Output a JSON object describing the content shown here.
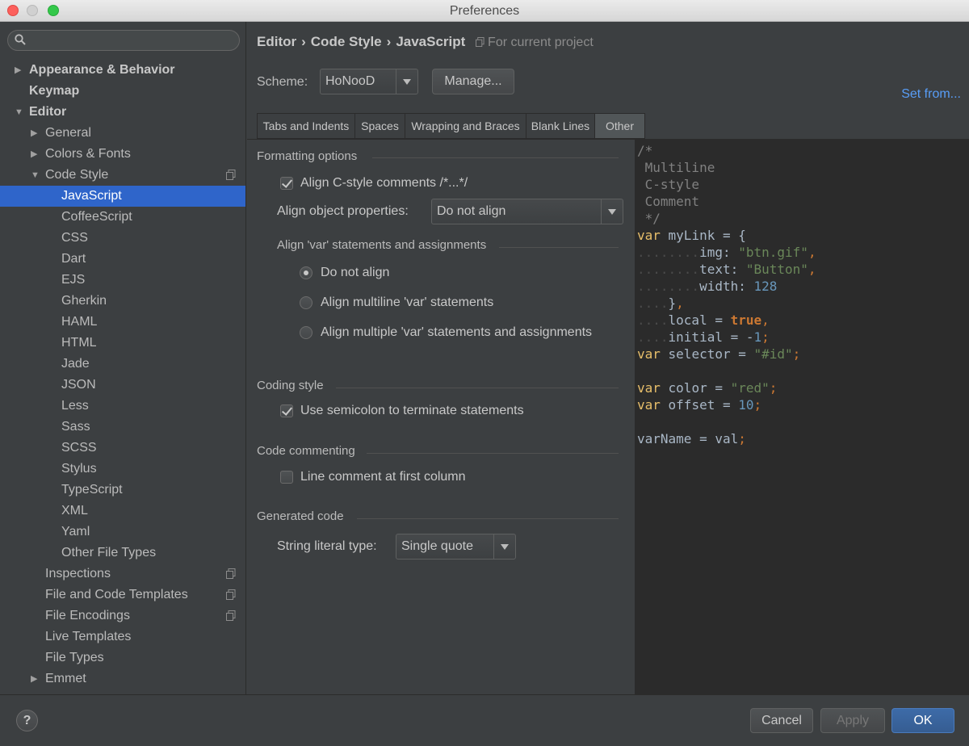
{
  "window": {
    "title": "Preferences"
  },
  "search": {
    "placeholder": ""
  },
  "sidebar": {
    "items": [
      {
        "label": "Appearance & Behavior"
      },
      {
        "label": "Keymap"
      },
      {
        "label": "Editor"
      },
      {
        "label": "General"
      },
      {
        "label": "Colors & Fonts"
      },
      {
        "label": "Code Style"
      },
      {
        "label": "JavaScript"
      },
      {
        "label": "CoffeeScript"
      },
      {
        "label": "CSS"
      },
      {
        "label": "Dart"
      },
      {
        "label": "EJS"
      },
      {
        "label": "Gherkin"
      },
      {
        "label": "HAML"
      },
      {
        "label": "HTML"
      },
      {
        "label": "Jade"
      },
      {
        "label": "JSON"
      },
      {
        "label": "Less"
      },
      {
        "label": "Sass"
      },
      {
        "label": "SCSS"
      },
      {
        "label": "Stylus"
      },
      {
        "label": "TypeScript"
      },
      {
        "label": "XML"
      },
      {
        "label": "Yaml"
      },
      {
        "label": "Other File Types"
      },
      {
        "label": "Inspections"
      },
      {
        "label": "File and Code Templates"
      },
      {
        "label": "File Encodings"
      },
      {
        "label": "Live Templates"
      },
      {
        "label": "File Types"
      },
      {
        "label": "Emmet"
      }
    ]
  },
  "breadcrumb": {
    "part1": "Editor",
    "part2": "Code Style",
    "part3": "JavaScript",
    "sep": "›",
    "project": "For current project"
  },
  "scheme": {
    "label": "Scheme:",
    "value": "HoNooD",
    "manage_label": "Manage...",
    "set_from": "Set from..."
  },
  "tabs": [
    "Tabs and Indents",
    "Spaces",
    "Wrapping and Braces",
    "Blank Lines",
    "Other"
  ],
  "active_tab": "Other",
  "formatting": {
    "title": "Formatting options",
    "align_comments": "Align C-style comments /*...*/",
    "align_comments_checked": true,
    "align_props_label": "Align object properties:",
    "align_props_value": "Do not align",
    "var_title": "Align 'var' statements and assignments",
    "radio_1": "Do not align",
    "radio_2": "Align multiline 'var' statements",
    "radio_3": "Align multiple 'var' statements and assignments",
    "selected_radio": "Do not align"
  },
  "coding": {
    "title": "Coding style",
    "semicolon": "Use semicolon to terminate statements",
    "semicolon_checked": true
  },
  "commenting": {
    "title": "Code commenting",
    "line_comment": "Line comment at first column",
    "line_comment_checked": false
  },
  "generated": {
    "title": "Generated code",
    "string_label": "String literal type:",
    "string_value": "Single quote"
  },
  "footer": {
    "help": "?",
    "cancel": "Cancel",
    "apply": "Apply",
    "ok": "OK"
  },
  "colors": {
    "selection": "#2f65ca",
    "link": "#589df6",
    "primary_button": "#365d92"
  }
}
